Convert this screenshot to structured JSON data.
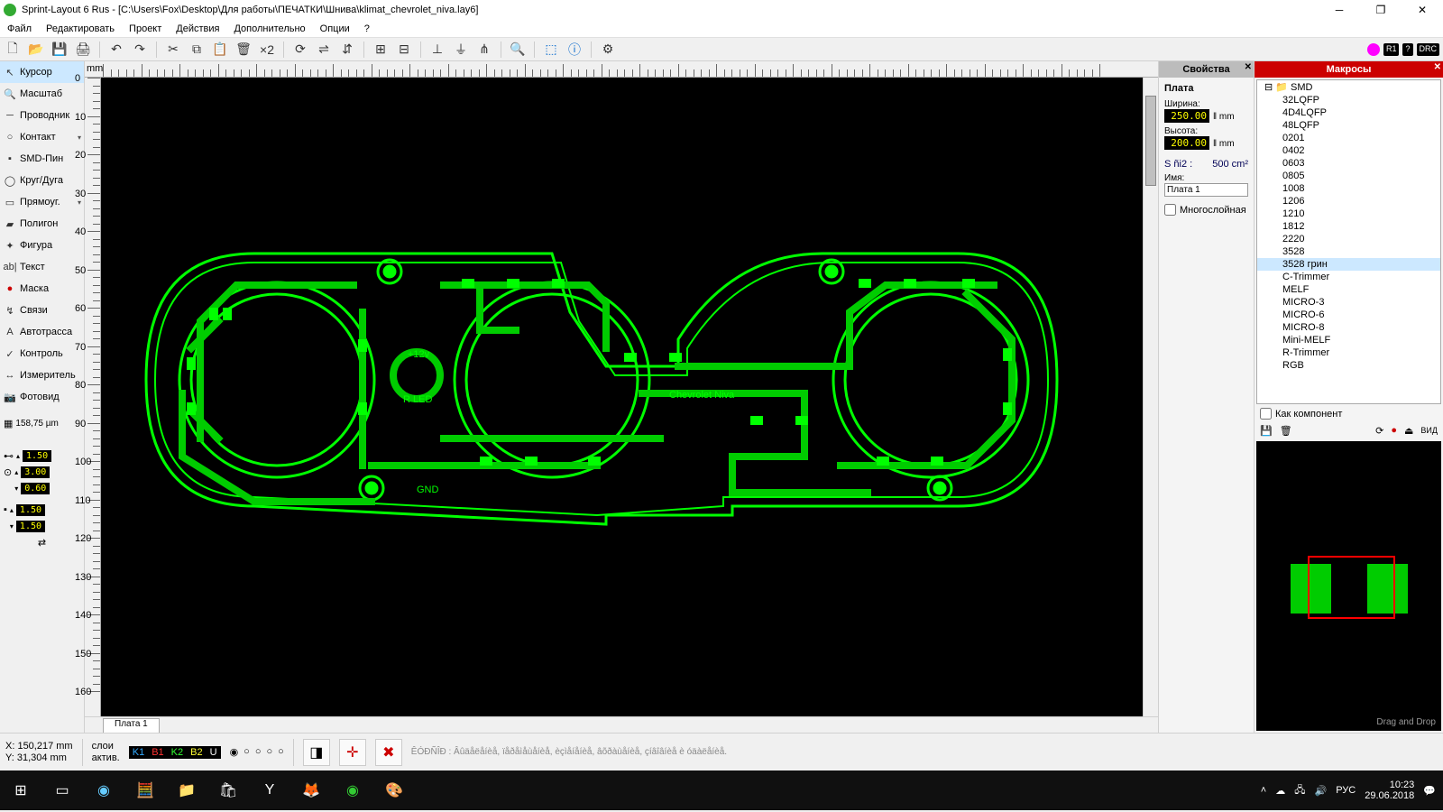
{
  "title": "Sprint-Layout 6 Rus - [C:\\Users\\Fox\\Desktop\\Для работы\\ПЕЧАТКИ\\Шнива\\klimat_chevrolet_niva.lay6]",
  "menu": [
    "Файл",
    "Редактировать",
    "Проект",
    "Действия",
    "Дополнительно",
    "Опции",
    "?"
  ],
  "tools": {
    "items": [
      {
        "icon": "↖",
        "label": "Курсор",
        "sel": true,
        "caret": false
      },
      {
        "icon": "🔍",
        "label": "Масштаб",
        "caret": false
      },
      {
        "icon": "─",
        "label": "Проводник",
        "caret": false
      },
      {
        "icon": "○",
        "label": "Контакт",
        "caret": true
      },
      {
        "icon": "▪",
        "label": "SMD-Пин",
        "caret": false
      },
      {
        "icon": "◯",
        "label": "Круг/Дуга",
        "caret": false
      },
      {
        "icon": "▭",
        "label": "Прямоуг.",
        "caret": true
      },
      {
        "icon": "▰",
        "label": "Полигон",
        "caret": false
      },
      {
        "icon": "✦",
        "label": "Фигура",
        "caret": false
      },
      {
        "icon": "ab|",
        "label": "Текст",
        "caret": false
      },
      {
        "icon": "●",
        "label": "Маска",
        "color": "#c00",
        "caret": false
      },
      {
        "icon": "↯",
        "label": "Связи",
        "caret": false
      },
      {
        "icon": "A",
        "label": "Автотрасса",
        "caret": false
      },
      {
        "icon": "✓",
        "label": "Контроль",
        "caret": false
      },
      {
        "icon": "↔",
        "label": "Измеритель",
        "caret": false
      },
      {
        "icon": "📷",
        "label": "Фотовид",
        "caret": false
      }
    ],
    "grid_label": "158,75 µm",
    "params": [
      "1.50",
      "3.00",
      "0.60",
      "1.50",
      "1.50"
    ]
  },
  "ruler_unit": "mm",
  "tab_name": "Плата 1",
  "props": {
    "title": "Свойства",
    "header": "Плата",
    "width_label": "Ширина:",
    "width": "250.00",
    "height_label": "Высота:",
    "height": "200.00",
    "unit": "‖ mm",
    "area_label": "S ñi2 :",
    "area_value": "500 cm²",
    "name_label": "Имя:",
    "name_value": "Плата 1",
    "multilayer": "Многослойная"
  },
  "macros": {
    "title": "Макросы",
    "root": "SMD",
    "items": [
      "32LQFP",
      "4D4LQFP",
      "48LQFP",
      "0201",
      "0402",
      "0603",
      "0805",
      "1008",
      "1206",
      "1210",
      "1812",
      "2220",
      "3528",
      "3528 грин",
      "C-Trimmer",
      "MELF",
      "MICRO-3",
      "MICRO-6",
      "MICRO-8",
      "Mini-MELF",
      "R-Trimmer",
      "RGB"
    ],
    "as_component": "Как компонент",
    "view_label": "ВИД",
    "dnd": "Drag and Drop"
  },
  "status": {
    "coord_x": "X:  150,217 mm",
    "coord_y": "Y:   31,304 mm",
    "layers_label": "слои",
    "active_label": "актив.",
    "layer_chips": [
      {
        "t": "K1",
        "c": "#3af"
      },
      {
        "t": "B1",
        "c": "#f33"
      },
      {
        "t": "K2",
        "c": "#3f3"
      },
      {
        "t": "B2",
        "c": "#ff3"
      },
      {
        "t": "U",
        "c": "#fff"
      }
    ],
    "hint": "ÊÓÐÑÎÐ : Âûäåëåíèå, ïåðåìåùåíèå, èçìåíåíèå, âõðàùåíèå, çíâîâíèå è óäàëåíèå."
  },
  "toolbar_badges": [
    "R1",
    "?",
    "DRC"
  ],
  "canvas_text": {
    "label": "Chevrolet Niva",
    "v12": "+12v",
    "rled": "R LED",
    "gnd": "GND"
  },
  "system": {
    "lang": "РУС",
    "time": "10:23",
    "date": "29.06.2018"
  }
}
